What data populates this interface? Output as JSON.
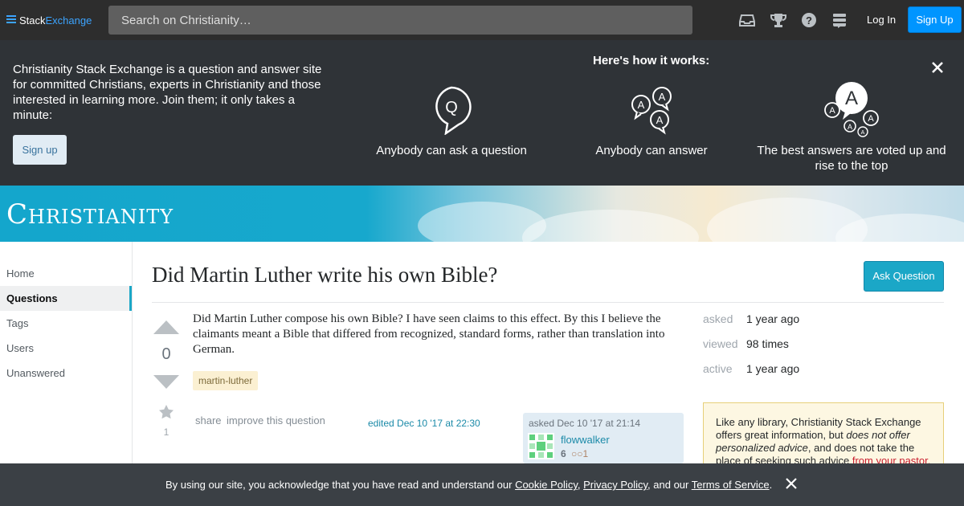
{
  "topbar": {
    "logo_word1": "Stack",
    "logo_word2": "Exchange",
    "search_placeholder": "Search on Christianity…",
    "icons": [
      "inbox-icon",
      "trophy-icon",
      "help-icon",
      "site-switcher-icon"
    ],
    "login_label": "Log In",
    "signup_label": "Sign Up"
  },
  "hero": {
    "intro": "Christianity Stack Exchange is a question and answer site for committed Christians, experts in Christianity and those interested in learning more. Join them; it only takes a minute:",
    "signup_label": "Sign up",
    "how_title": "Here's how it works:",
    "steps": [
      {
        "label": "Anybody can ask a question"
      },
      {
        "label": "Anybody can answer"
      },
      {
        "label": "The best answers are voted up and rise to the top"
      }
    ],
    "icon_letters": {
      "q": "Q",
      "a": "A"
    }
  },
  "banner": {
    "site_title": "Christianity"
  },
  "leftnav": {
    "items": [
      {
        "label": "Home",
        "active": false
      },
      {
        "label": "Questions",
        "active": true
      },
      {
        "label": "Tags",
        "active": false
      },
      {
        "label": "Users",
        "active": false
      },
      {
        "label": "Unanswered",
        "active": false
      }
    ]
  },
  "question": {
    "title": "Did Martin Luther write his own Bible?",
    "ask_button": "Ask Question",
    "body": "Did Martin Luther compose his own Bible? I have seen claims to this effect. By this I believe the claimants meant a Bible that differed from recognized, standard forms, rather than translation into German.",
    "vote_count": "0",
    "favorite_count": "1",
    "tags": [
      "martin-luther"
    ],
    "menu": {
      "share": "share",
      "improve": "improve this question"
    },
    "edited": "edited Dec 10 '17 at 22:30",
    "owner": {
      "asked": "asked Dec 10 '17 at 21:14",
      "name": "flowwalker",
      "rep": "6",
      "bronze_badges": "1"
    }
  },
  "stats": [
    {
      "label": "asked",
      "value": "1 year ago"
    },
    {
      "label": "viewed",
      "value": "98 times"
    },
    {
      "label": "active",
      "value": "1 year ago"
    }
  ],
  "notice": {
    "part1": "Like any library, Christianity Stack Exchange offers great information, but ",
    "em1": "does not offer personalized advice",
    "part2": ", and does not take the place of seeking such advice ",
    "link": "from your pastor."
  },
  "cookie": {
    "prefix": "By using our site, you acknowledge that you have read and understand our ",
    "cookie_policy": "Cookie Policy",
    "sep1": ", ",
    "privacy_policy": "Privacy Policy",
    "sep2": ", and our ",
    "terms": "Terms of Service",
    "suffix": "."
  },
  "colors": {
    "accent": "#1ba7c7",
    "topbar": "#2d2d2d",
    "hero": "#2f3337",
    "signup": "#0095ff",
    "tag_bg": "#fbf0d2",
    "notice_bg": "#fdf7e2"
  }
}
